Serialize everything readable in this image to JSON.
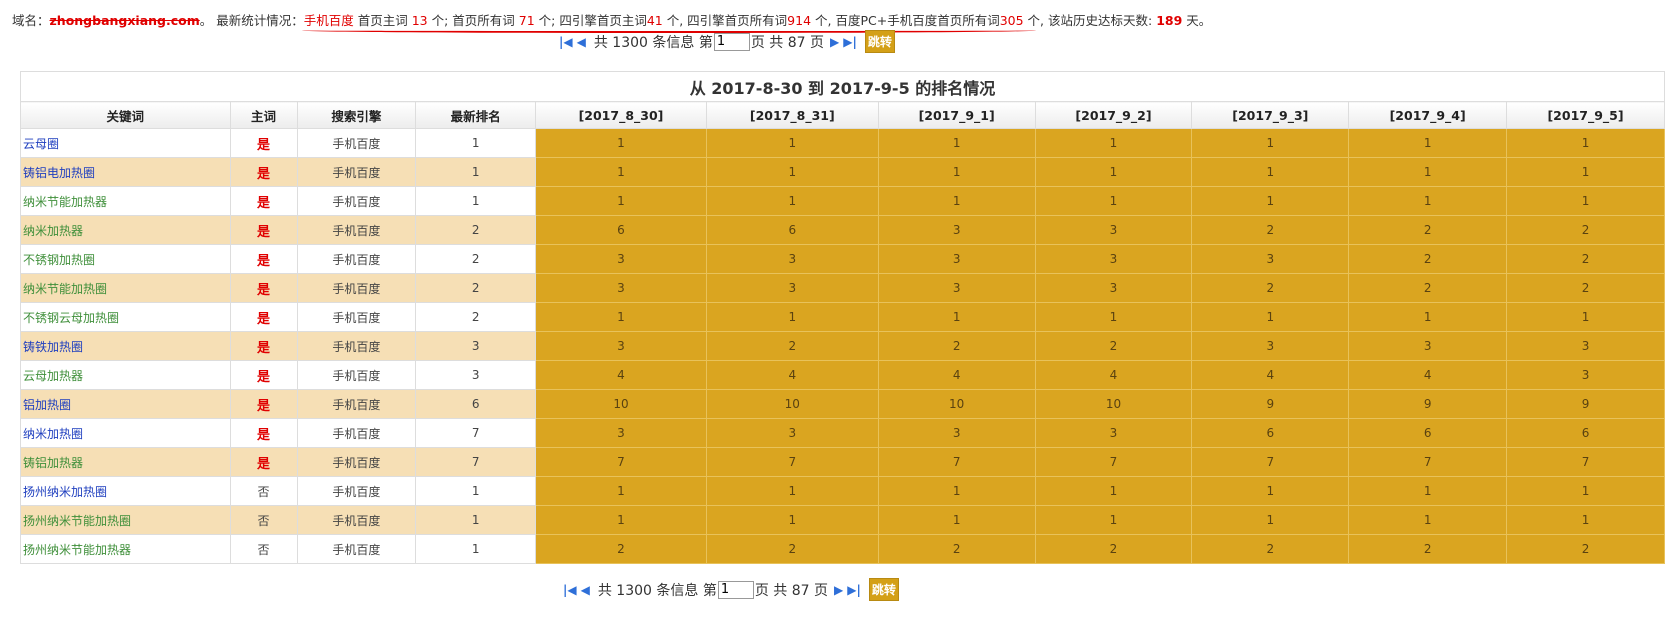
{
  "summary": {
    "domain_label": "域名：",
    "domain_value": "zhongbangxiang.com",
    "stat_label": "。 最新统计情况：",
    "engine": "手机百度",
    "t1": " 首页主词 ",
    "v1": "13",
    "t2": " 个; 首页所有词 ",
    "v2": "71",
    "t3": " 个; 四引擎首页主词",
    "v3": "41",
    "t4": " 个, 四引擎首页所有词",
    "v4": "914",
    "t5": " 个, 百度PC+手机百度首页所有词",
    "v5": "305",
    "t6": " 个",
    "t7": ", 该站历史达标天数: ",
    "v7": "189",
    "t8": " 天。"
  },
  "pager": {
    "first": "|◀",
    "prev": "◀",
    "total_text": "共 1300 条信息 第",
    "page_value": "1",
    "pages_text": "页 共 87 页",
    "next": "▶",
    "last": "▶|",
    "go_label": "跳转"
  },
  "table": {
    "title": "从 2017-8-30 到 2017-9-5 的排名情况",
    "headers": [
      "关键词",
      "主词",
      "搜索引擎",
      "最新排名",
      "[2017_8_30]",
      "[2017_8_31]",
      "[2017_9_1]",
      "[2017_9_2]",
      "[2017_9_3]",
      "[2017_9_4]",
      "[2017_9_5]"
    ],
    "rows": [
      {
        "keyword": "云母圈",
        "main": "是",
        "engine": "手机百度",
        "latest": "1",
        "days": [
          "1",
          "1",
          "1",
          "1",
          "1",
          "1",
          "1"
        ],
        "color": "blue"
      },
      {
        "keyword": "铸铝电加热圈",
        "main": "是",
        "engine": "手机百度",
        "latest": "1",
        "days": [
          "1",
          "1",
          "1",
          "1",
          "1",
          "1",
          "1"
        ],
        "color": "blue"
      },
      {
        "keyword": "纳米节能加热器",
        "main": "是",
        "engine": "手机百度",
        "latest": "1",
        "days": [
          "1",
          "1",
          "1",
          "1",
          "1",
          "1",
          "1"
        ],
        "color": "green"
      },
      {
        "keyword": "纳米加热器",
        "main": "是",
        "engine": "手机百度",
        "latest": "2",
        "days": [
          "6",
          "6",
          "3",
          "3",
          "2",
          "2",
          "2"
        ],
        "color": "green"
      },
      {
        "keyword": "不锈钢加热圈",
        "main": "是",
        "engine": "手机百度",
        "latest": "2",
        "days": [
          "3",
          "3",
          "3",
          "3",
          "3",
          "2",
          "2"
        ],
        "color": "green"
      },
      {
        "keyword": "纳米节能加热圈",
        "main": "是",
        "engine": "手机百度",
        "latest": "2",
        "days": [
          "3",
          "3",
          "3",
          "3",
          "2",
          "2",
          "2"
        ],
        "color": "green"
      },
      {
        "keyword": "不锈钢云母加热圈",
        "main": "是",
        "engine": "手机百度",
        "latest": "2",
        "days": [
          "1",
          "1",
          "1",
          "1",
          "1",
          "1",
          "1"
        ],
        "color": "green"
      },
      {
        "keyword": "铸铁加热圈",
        "main": "是",
        "engine": "手机百度",
        "latest": "3",
        "days": [
          "3",
          "2",
          "2",
          "2",
          "3",
          "3",
          "3"
        ],
        "color": "blue"
      },
      {
        "keyword": "云母加热器",
        "main": "是",
        "engine": "手机百度",
        "latest": "3",
        "days": [
          "4",
          "4",
          "4",
          "4",
          "4",
          "4",
          "3"
        ],
        "color": "green"
      },
      {
        "keyword": "铝加热圈",
        "main": "是",
        "engine": "手机百度",
        "latest": "6",
        "days": [
          "10",
          "10",
          "10",
          "10",
          "9",
          "9",
          "9"
        ],
        "color": "blue"
      },
      {
        "keyword": "纳米加热圈",
        "main": "是",
        "engine": "手机百度",
        "latest": "7",
        "days": [
          "3",
          "3",
          "3",
          "3",
          "6",
          "6",
          "6"
        ],
        "color": "blue"
      },
      {
        "keyword": "铸铝加热器",
        "main": "是",
        "engine": "手机百度",
        "latest": "7",
        "days": [
          "7",
          "7",
          "7",
          "7",
          "7",
          "7",
          "7"
        ],
        "color": "green"
      },
      {
        "keyword": "扬州纳米加热圈",
        "main": "否",
        "engine": "手机百度",
        "latest": "1",
        "days": [
          "1",
          "1",
          "1",
          "1",
          "1",
          "1",
          "1"
        ],
        "color": "blue"
      },
      {
        "keyword": "扬州纳米节能加热圈",
        "main": "否",
        "engine": "手机百度",
        "latest": "1",
        "days": [
          "1",
          "1",
          "1",
          "1",
          "1",
          "1",
          "1"
        ],
        "color": "green"
      },
      {
        "keyword": "扬州纳米节能加热器",
        "main": "否",
        "engine": "手机百度",
        "latest": "1",
        "days": [
          "2",
          "2",
          "2",
          "2",
          "2",
          "2",
          "2"
        ],
        "color": "green"
      }
    ]
  },
  "colors": {
    "highlight_red": "#e00000",
    "gold_cell": "#daa520",
    "stripe": "#f6dfb5",
    "link_blue": "#1f3fbf",
    "link_green": "#3f8f3a"
  }
}
